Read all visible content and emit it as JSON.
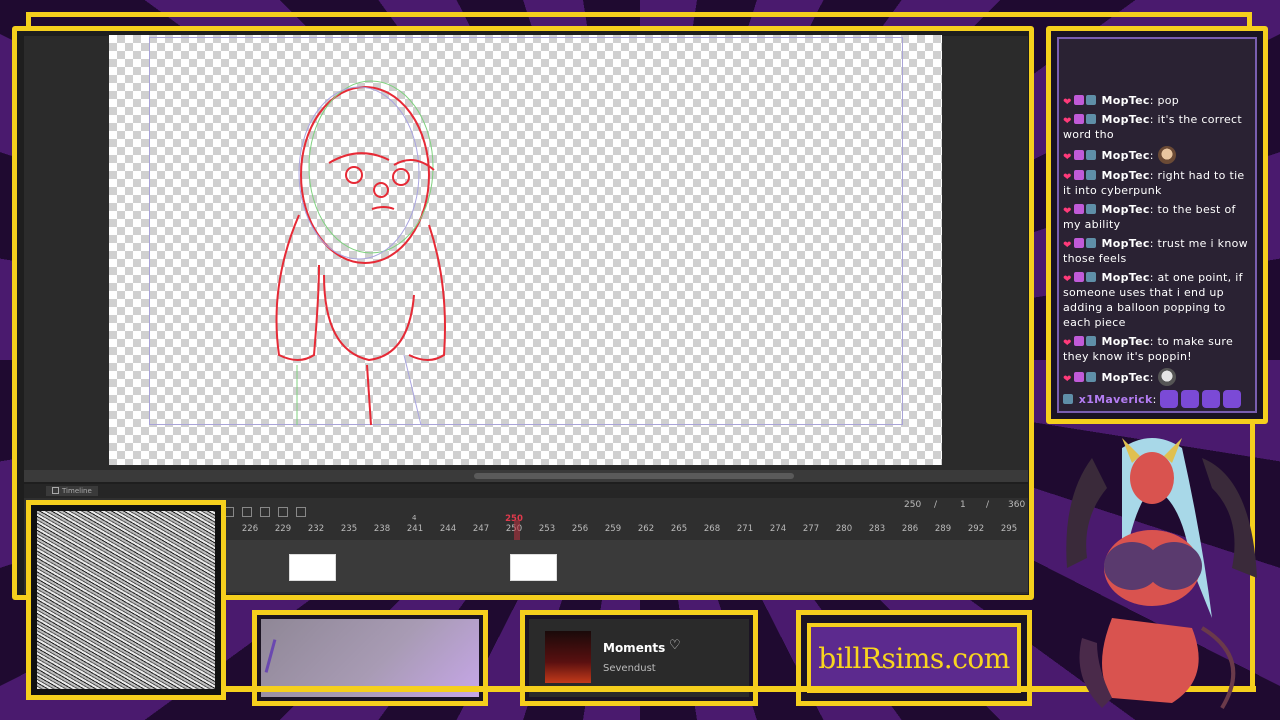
{
  "timeline": {
    "tab_label": "Timeline",
    "frame_current": "250",
    "frame_sep1": "/",
    "frame_value": "1",
    "frame_sep2": "/",
    "frame_total": "360",
    "current_frame_marker": "250",
    "marker_small": "4",
    "ticks": [
      "226",
      "229",
      "232",
      "235",
      "238",
      "241",
      "244",
      "247",
      "250",
      "253",
      "256",
      "259",
      "262",
      "265",
      "268",
      "271",
      "274",
      "277",
      "280",
      "283",
      "286",
      "289",
      "292",
      "295"
    ]
  },
  "chat": {
    "messages": [
      {
        "user": "MopTec",
        "text": ": pop"
      },
      {
        "user": "MopTec",
        "text": ": it's the correct word tho"
      },
      {
        "user": "MopTec",
        "text": ":",
        "emote": "face1"
      },
      {
        "user": "MopTec",
        "text": ": right had to tie it into cyberpunk"
      },
      {
        "user": "MopTec",
        "text": ": to the best of my ability"
      },
      {
        "user": "MopTec",
        "text": ": trust me i know those feels"
      },
      {
        "user": "MopTec",
        "text": ": at one point, if someone uses that i end up adding a balloon popping to each piece"
      },
      {
        "user": "MopTec",
        "text": ": to make sure they know it's poppin!"
      },
      {
        "user": "MopTec",
        "text": ":",
        "emote": "face2"
      },
      {
        "user": "x1Maverick",
        "text": ":",
        "emote": "purple"
      }
    ]
  },
  "music": {
    "song": "Moments",
    "artist": "Sevendust"
  },
  "site": {
    "text": "billRsims.com"
  },
  "colors": {
    "frame_yellow": "#f5cf1d",
    "bg_purple": "#3a1458",
    "site_bg": "#5c2a8e"
  }
}
